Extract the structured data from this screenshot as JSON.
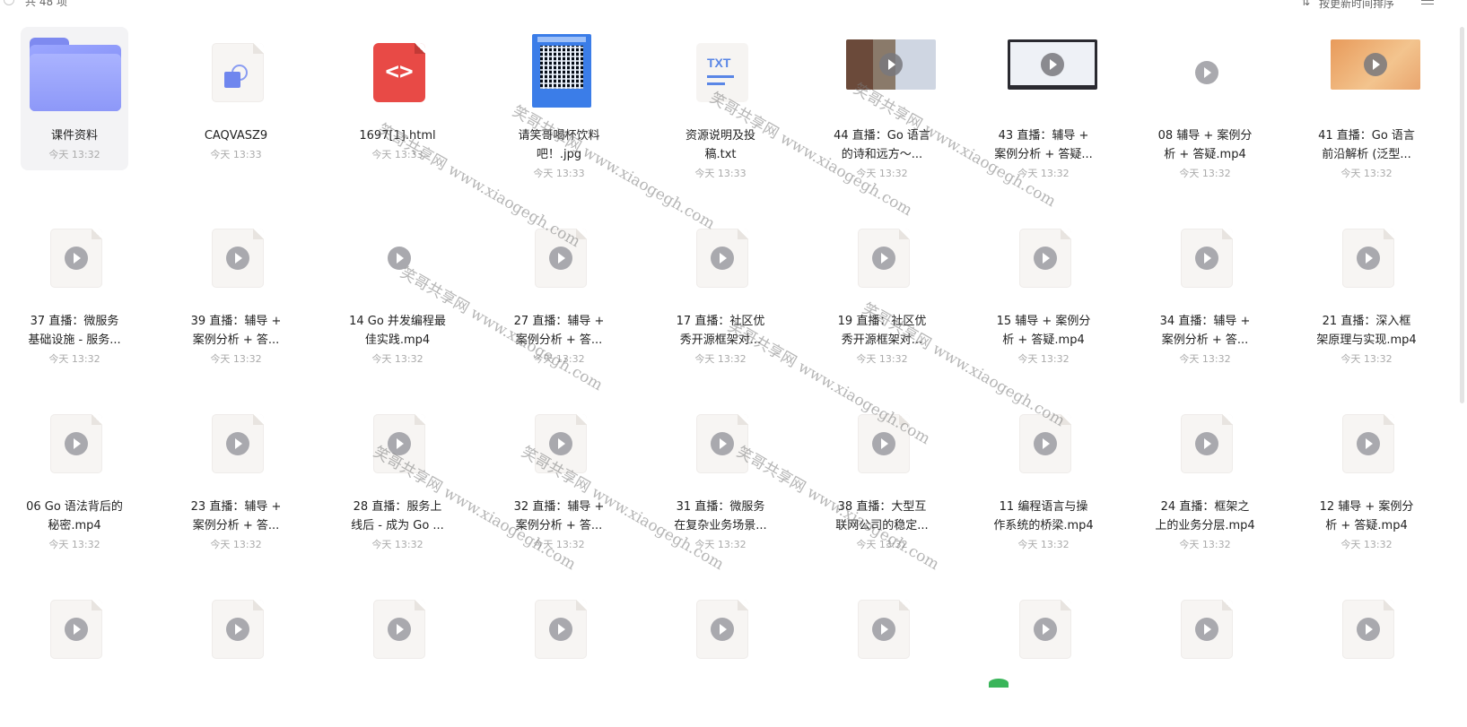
{
  "toolbar": {
    "count_label": "共 48 项",
    "sort_label": "按更新时间排序",
    "sort_icon": "sort-icon",
    "menu_icon": "list-view-icon"
  },
  "items": [
    {
      "name": "课件资料",
      "name2": "",
      "time": "今天 13:32",
      "type": "folder"
    },
    {
      "name": "CAQVASZ9",
      "name2": "",
      "time": "今天 13:33",
      "type": "shape"
    },
    {
      "name": "1697[1].html",
      "name2": "",
      "time": "今天 13:33",
      "type": "html"
    },
    {
      "name": "请笑哥喝杯饮料",
      "name2": "吧！.jpg",
      "time": "今天 13:33",
      "type": "qr"
    },
    {
      "name": "资源说明及投",
      "name2": "稿.txt",
      "time": "今天 13:33",
      "type": "txt"
    },
    {
      "name": "44 直播：Go 语言",
      "name2": "的诗和远方～...",
      "time": "今天 13:32",
      "type": "video1"
    },
    {
      "name": "43 直播：辅导 +",
      "name2": "案例分析 + 答疑...",
      "time": "今天 13:32",
      "type": "video2"
    },
    {
      "name": "08 辅导 + 案例分",
      "name2": "析 + 答疑.mp4",
      "time": "今天 13:32",
      "type": "videoplain"
    },
    {
      "name": "41 直播：Go 语言",
      "name2": "前沿解析 (泛型...",
      "time": "今天 13:32",
      "type": "video3"
    },
    {
      "name": "37 直播：微服务",
      "name2": "基础设施 - 服务...",
      "time": "今天 13:32",
      "type": "mp4"
    },
    {
      "name": "39 直播：辅导 +",
      "name2": "案例分析 + 答...",
      "time": "今天 13:32",
      "type": "mp4"
    },
    {
      "name": "14 Go 并发编程最",
      "name2": "佳实践.mp4",
      "time": "今天 13:32",
      "type": "videoplain"
    },
    {
      "name": "27 直播：辅导 +",
      "name2": "案例分析 + 答...",
      "time": "今天 13:32",
      "type": "mp4"
    },
    {
      "name": "17 直播：社区优",
      "name2": "秀开源框架对...",
      "time": "今天 13:32",
      "type": "mp4"
    },
    {
      "name": "19 直播：社区优",
      "name2": "秀开源框架对...",
      "time": "今天 13:32",
      "type": "mp4"
    },
    {
      "name": "15 辅导 + 案例分",
      "name2": "析 + 答疑.mp4",
      "time": "今天 13:32",
      "type": "mp4"
    },
    {
      "name": "34 直播：辅导 +",
      "name2": "案例分析 + 答...",
      "time": "今天 13:32",
      "type": "mp4"
    },
    {
      "name": "21 直播：深入框",
      "name2": "架原理与实现.mp4",
      "time": "今天 13:32",
      "type": "mp4"
    },
    {
      "name": "06 Go 语法背后的",
      "name2": "秘密.mp4",
      "time": "今天 13:32",
      "type": "mp4"
    },
    {
      "name": "23 直播：辅导 +",
      "name2": "案例分析 + 答...",
      "time": "今天 13:32",
      "type": "mp4"
    },
    {
      "name": "28 直播：服务上",
      "name2": "线后 - 成为 Go ...",
      "time": "今天 13:32",
      "type": "mp4"
    },
    {
      "name": "32 直播：辅导 +",
      "name2": "案例分析 + 答...",
      "time": "今天 13:32",
      "type": "mp4"
    },
    {
      "name": "31 直播：微服务",
      "name2": "在复杂业务场景...",
      "time": "今天 13:32",
      "type": "mp4"
    },
    {
      "name": "38 直播：大型互",
      "name2": "联网公司的稳定...",
      "time": "今天 13:32",
      "type": "mp4"
    },
    {
      "name": "11 编程语言与操",
      "name2": "作系统的桥梁.mp4",
      "time": "今天 13:32",
      "type": "mp4"
    },
    {
      "name": "24 直播：框架之",
      "name2": "上的业务分层.mp4",
      "time": "今天 13:32",
      "type": "mp4"
    },
    {
      "name": "12 辅导 + 案例分",
      "name2": "析 + 答疑.mp4",
      "time": "今天 13:32",
      "type": "mp4"
    },
    {
      "name": "",
      "name2": "",
      "time": "",
      "type": "mp4"
    },
    {
      "name": "",
      "name2": "",
      "time": "",
      "type": "mp4"
    },
    {
      "name": "",
      "name2": "",
      "time": "",
      "type": "mp4"
    },
    {
      "name": "",
      "name2": "",
      "time": "",
      "type": "mp4"
    },
    {
      "name": "",
      "name2": "",
      "time": "",
      "type": "mp4"
    },
    {
      "name": "",
      "name2": "",
      "time": "",
      "type": "mp4"
    },
    {
      "name": "",
      "name2": "",
      "time": "",
      "type": "mp4"
    },
    {
      "name": "",
      "name2": "",
      "time": "",
      "type": "mp4"
    },
    {
      "name": "",
      "name2": "",
      "time": "",
      "type": "mp4"
    }
  ],
  "watermark_text": "笑哥共享网 www.xiaogegh.com",
  "colors": {
    "accent": "#7a86f2",
    "html": "#e84a46",
    "qr": "#3b7de8",
    "txt": "#5a86e6"
  }
}
